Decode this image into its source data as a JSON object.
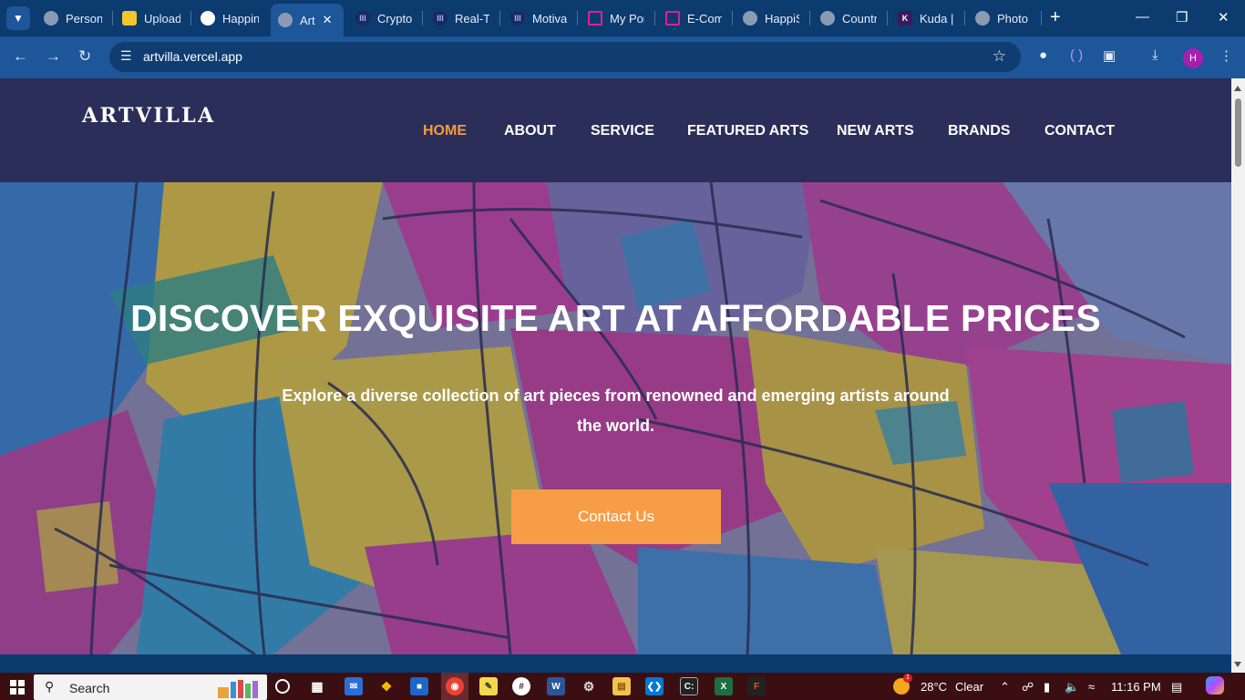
{
  "browser": {
    "tabs": [
      {
        "title": "Personal",
        "favicon": "globe-icon",
        "active": false
      },
      {
        "title": "Upload",
        "favicon": "upload-icon",
        "active": false
      },
      {
        "title": "Happin",
        "favicon": "github-icon",
        "active": false
      },
      {
        "title": "Art",
        "favicon": "globe-icon",
        "active": true
      },
      {
        "title": "Crypto",
        "favicon": "site-icon",
        "active": false
      },
      {
        "title": "Real-Ti",
        "favicon": "site-icon",
        "active": false
      },
      {
        "title": "Motiva",
        "favicon": "site-icon",
        "active": false
      },
      {
        "title": "My Por",
        "favicon": "portfolio-icon",
        "active": false
      },
      {
        "title": "E-Com",
        "favicon": "portfolio-icon",
        "active": false
      },
      {
        "title": "HappiS",
        "favicon": "globe-icon",
        "active": false
      },
      {
        "title": "Countr",
        "favicon": "globe-icon",
        "active": false
      },
      {
        "title": "Kuda |",
        "favicon": "kuda-icon",
        "active": false
      },
      {
        "title": "Photo",
        "favicon": "globe-icon",
        "active": false
      }
    ],
    "url": "artvilla.vercel.app",
    "profile_initial": "H"
  },
  "site": {
    "logo": "ARTVILLA",
    "nav": [
      {
        "label": "HOME",
        "active": true
      },
      {
        "label": "ABOUT",
        "active": false
      },
      {
        "label": "SERVICE",
        "active": false
      },
      {
        "label": "FEATURED ARTS",
        "active": false
      },
      {
        "label": "NEW ARTS",
        "active": false
      },
      {
        "label": "BRANDS",
        "active": false
      },
      {
        "label": "CONTACT",
        "active": false
      }
    ],
    "hero": {
      "title": "DISCOVER EXQUISITE ART AT AFFORDABLE PRICES",
      "subtitle": "Explore a diverse collection of art pieces from renowned and emerging artists around the world.",
      "cta": "Contact Us"
    }
  },
  "taskbar": {
    "search_label": "Search",
    "weather": {
      "temp": "28°C",
      "condition": "Clear",
      "badge": "1"
    },
    "time": "11:16 PM"
  },
  "colors": {
    "header_bg": "#2b2e58",
    "nav_active": "#f59a3f",
    "cta_bg": "#f89d47",
    "chrome_bg": "#0c3b70",
    "taskbar_bg": "#3b0f12"
  }
}
